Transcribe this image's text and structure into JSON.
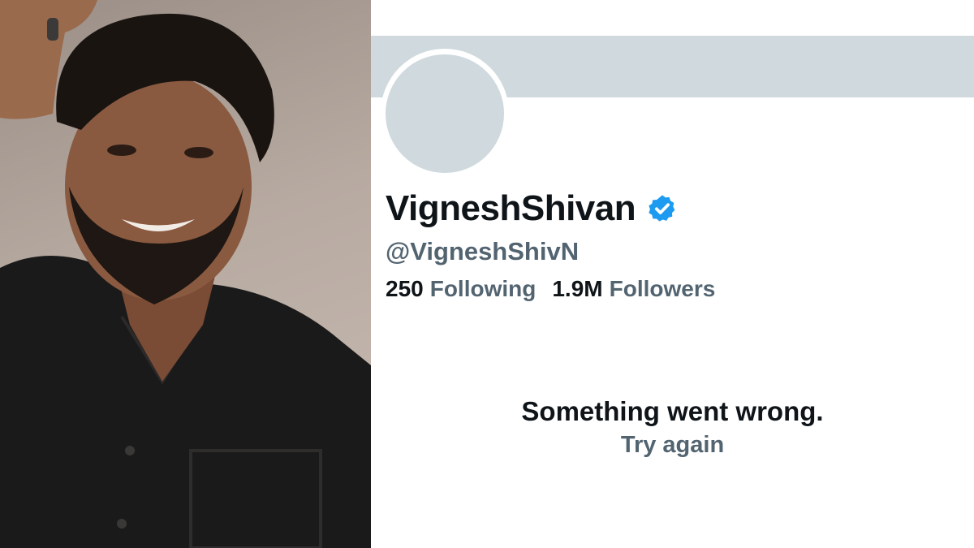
{
  "profile": {
    "display_name": "VigneshShivan",
    "handle": "@VigneshShivN",
    "verified_icon": "verified-badge-icon",
    "following_count": "250",
    "following_label": "Following",
    "followers_count": "1.9M",
    "followers_label": "Followers"
  },
  "error": {
    "message": "Something went wrong.",
    "retry_label": "Try again"
  },
  "colors": {
    "banner": "#cfd9de",
    "verified": "#1d9bf0",
    "primary_text": "#0f1419",
    "secondary_text": "#536471"
  }
}
